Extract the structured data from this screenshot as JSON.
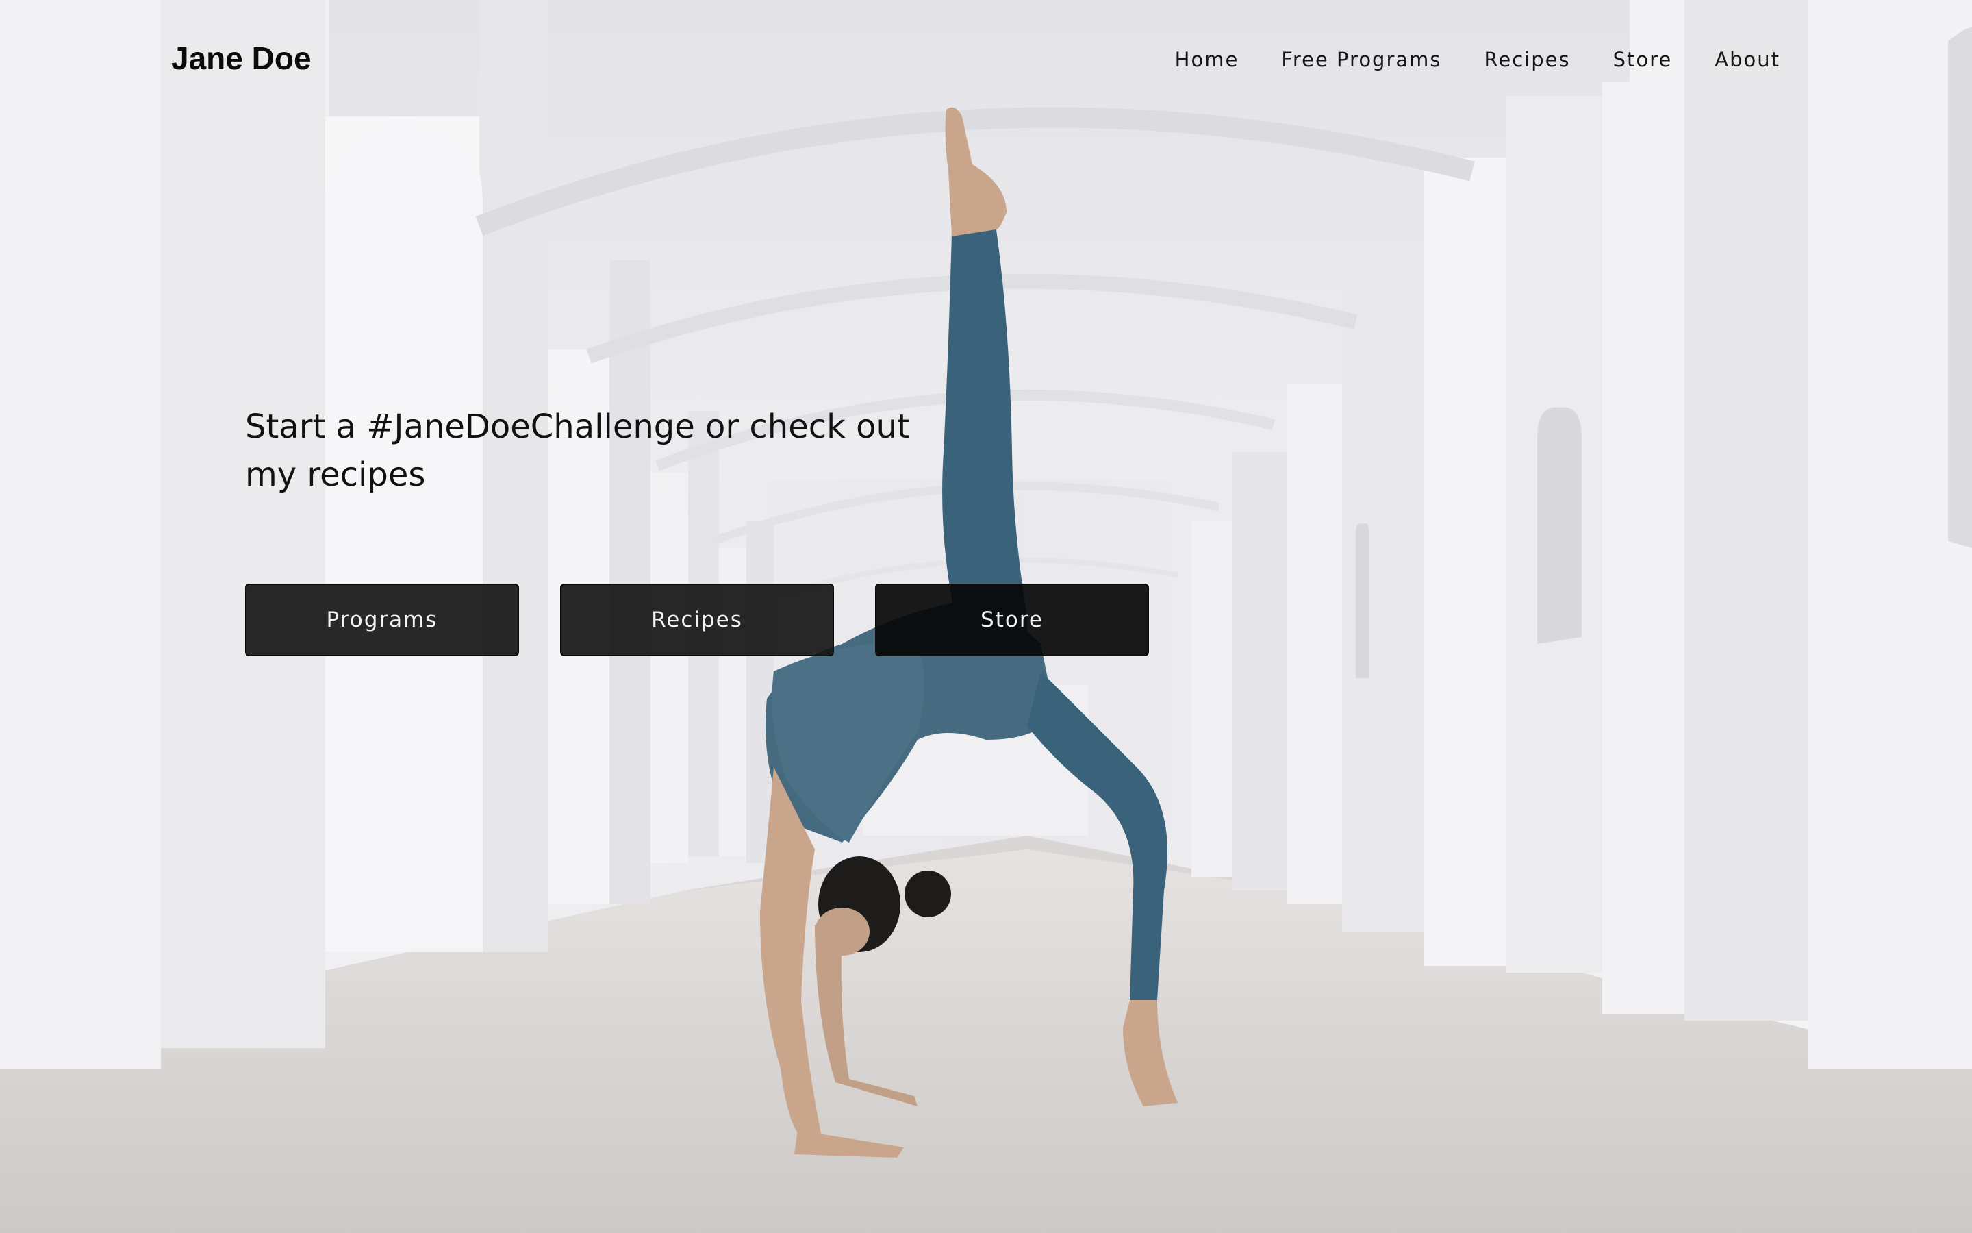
{
  "site": {
    "brand": "Jane Doe"
  },
  "nav": {
    "items": [
      {
        "label": "Home"
      },
      {
        "label": "Free Programs"
      },
      {
        "label": "Recipes"
      },
      {
        "label": "Store"
      },
      {
        "label": "About"
      }
    ]
  },
  "hero": {
    "headline": "Start a #JaneDoeChallenge or check out my recipes",
    "buttons": [
      {
        "label": "Programs"
      },
      {
        "label": "Recipes"
      },
      {
        "label": "Store"
      }
    ],
    "image": "yoga-pose-photo"
  },
  "colors": {
    "text": "#111111",
    "button_bg": "#1a1a1a",
    "button_text": "#f4f4f4",
    "legging": "#3a627a"
  }
}
